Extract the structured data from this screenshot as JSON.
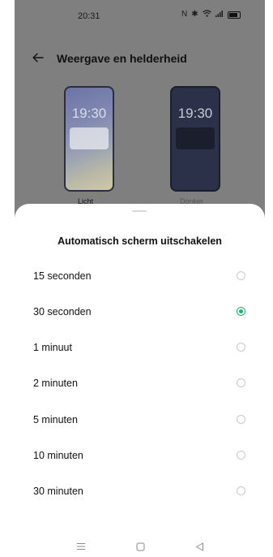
{
  "status_bar": {
    "time": "20:31",
    "icons": [
      "nfc-icon",
      "bluetooth-icon",
      "wifi-icon",
      "signal-icon",
      "battery-icon"
    ]
  },
  "header": {
    "title": "Weergave en helderheid"
  },
  "themes": {
    "light": {
      "clock": "19:30",
      "label": "Licht"
    },
    "dark": {
      "clock": "19:30",
      "label": "Donker"
    }
  },
  "dialog": {
    "title": "Automatisch scherm uitschakelen",
    "options": [
      {
        "label": "15 seconden",
        "selected": false
      },
      {
        "label": "30 seconden",
        "selected": true
      },
      {
        "label": "1 minuut",
        "selected": false
      },
      {
        "label": "2 minuten",
        "selected": false
      },
      {
        "label": "5 minuten",
        "selected": false
      },
      {
        "label": "10 minuten",
        "selected": false
      },
      {
        "label": "30 minuten",
        "selected": false
      }
    ]
  },
  "nav_bar": {
    "icons": [
      "menu-icon",
      "home-icon",
      "back-triangle-icon"
    ]
  },
  "colors": {
    "accent": "#20b26f",
    "scrim": "#7f7f7f"
  }
}
